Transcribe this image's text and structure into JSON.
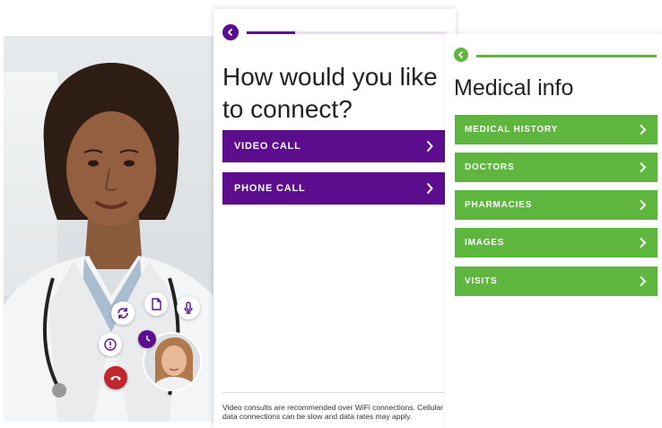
{
  "connect": {
    "title": "How would you like to connect?",
    "progress_fraction": 0.24,
    "options": [
      {
        "label": "VIDEO CALL"
      },
      {
        "label": "PHONE CALL"
      }
    ],
    "footnote": "Video consults are recommended over WiFi connections. Cellular data connections can be slow and data rates may apply."
  },
  "medical": {
    "title": "Medical info",
    "items": [
      {
        "label": "MEDICAL HISTORY"
      },
      {
        "label": "DOCTORS"
      },
      {
        "label": "PHARMACIES"
      },
      {
        "label": "IMAGES"
      },
      {
        "label": "VISITS"
      }
    ]
  },
  "call_controls": [
    "switch-camera-icon",
    "document-icon",
    "microphone-icon",
    "alert-icon",
    "end-call-icon",
    "rotate-icon"
  ],
  "colors": {
    "purple": "#5b0d8e",
    "green": "#5fb63e",
    "end_call_red": "#c0262d"
  }
}
